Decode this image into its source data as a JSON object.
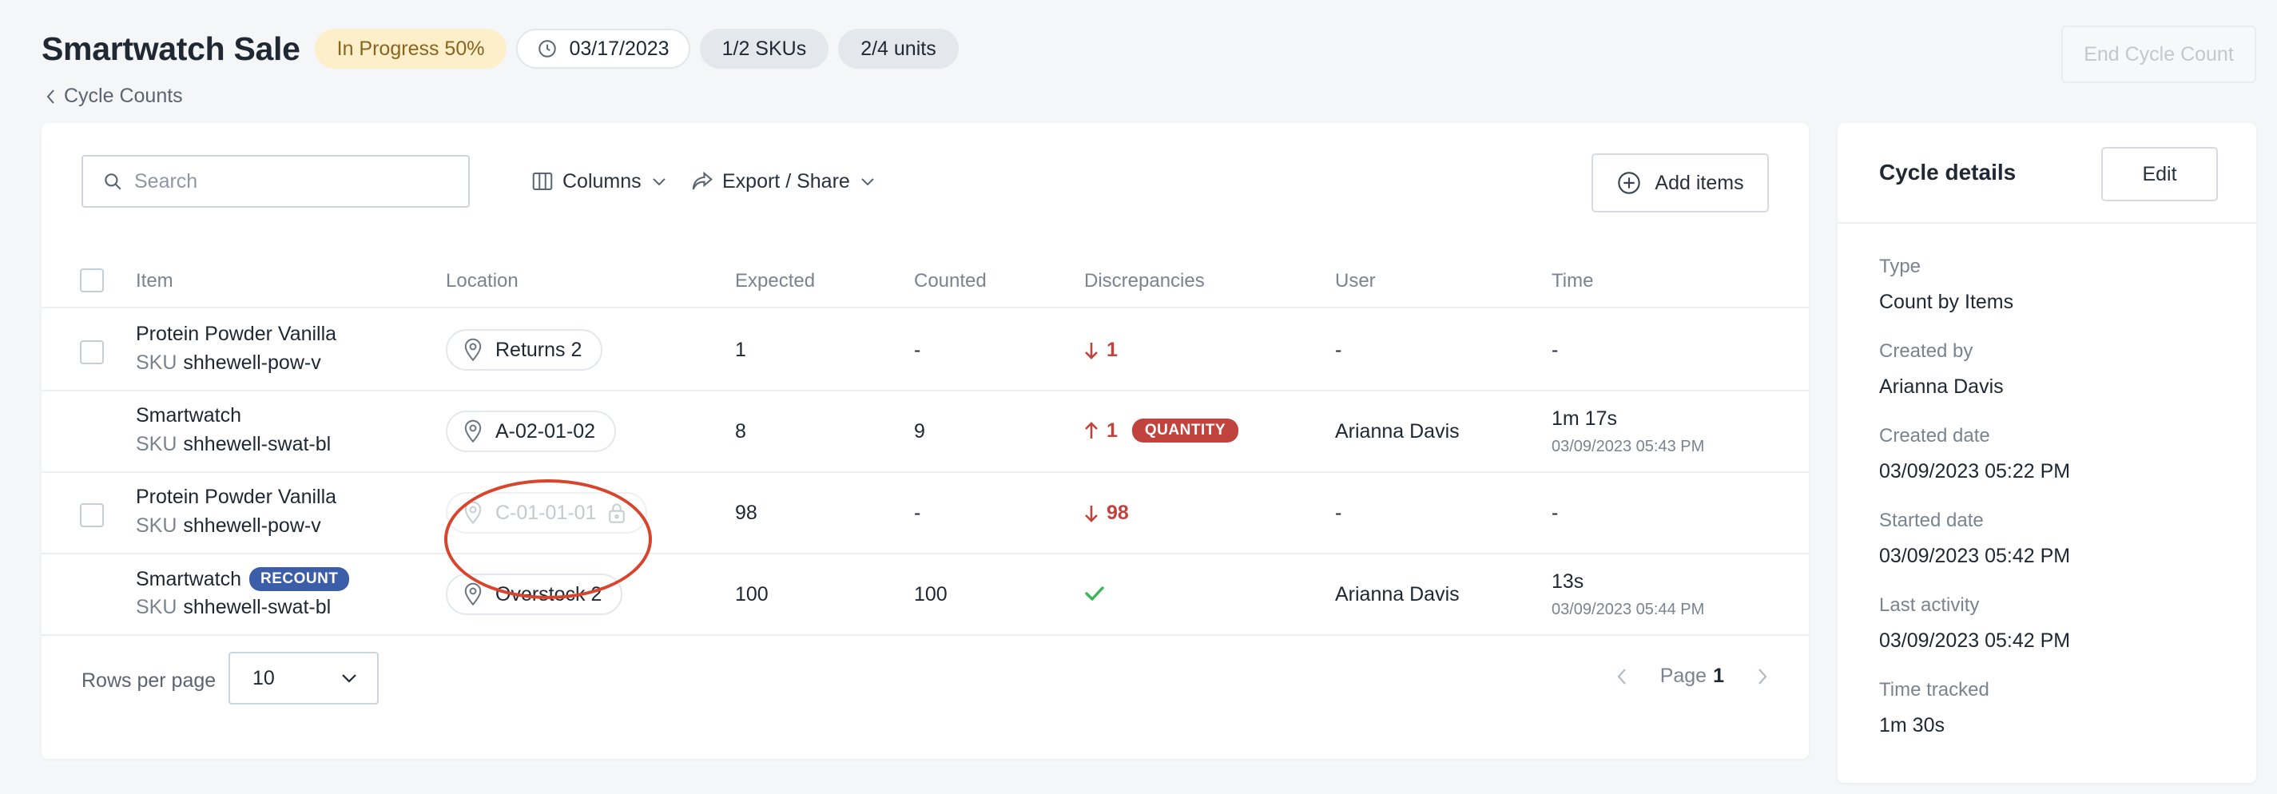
{
  "header": {
    "title": "Smartwatch Sale",
    "status": "In Progress 50%",
    "date": "03/17/2023",
    "skus": "1/2 SKUs",
    "units": "2/4 units",
    "end_button": "End Cycle Count",
    "breadcrumb": "Cycle Counts"
  },
  "toolbar": {
    "search_placeholder": "Search",
    "columns_label": "Columns",
    "export_label": "Export / Share",
    "add_items_label": "Add items"
  },
  "table": {
    "headers": {
      "item": "Item",
      "location": "Location",
      "expected": "Expected",
      "counted": "Counted",
      "discrepancies": "Discrepancies",
      "user": "User",
      "time": "Time"
    },
    "sku_label": "SKU",
    "rows": [
      {
        "name": "Protein Powder Vanilla",
        "sku": "shhewell-pow-v",
        "location": "Returns 2",
        "expected": "1",
        "counted": "-",
        "discrepancy": "1",
        "discrepancy_dir": "down",
        "user": "-",
        "time": "-",
        "time_sub": ""
      },
      {
        "name": "Smartwatch",
        "sku": "shhewell-swat-bl",
        "location": "A-02-01-02",
        "expected": "8",
        "counted": "9",
        "discrepancy": "1",
        "discrepancy_dir": "up",
        "discrepancy_badge": "QUANTITY",
        "user": "Arianna Davis",
        "time": "1m 17s",
        "time_sub": "03/09/2023 05:43 PM"
      },
      {
        "name": "Protein Powder Vanilla",
        "sku": "shhewell-pow-v",
        "location": "C-01-01-01",
        "expected": "98",
        "counted": "-",
        "discrepancy": "98",
        "discrepancy_dir": "down",
        "user": "-",
        "time": "-",
        "time_sub": ""
      },
      {
        "name": "Smartwatch",
        "badge": "RECOUNT",
        "sku": "shhewell-swat-bl",
        "location": "Overstock 2",
        "expected": "100",
        "counted": "100",
        "discrepancy": "",
        "discrepancy_dir": "check",
        "user": "Arianna Davis",
        "time": "13s",
        "time_sub": "03/09/2023 05:44 PM"
      }
    ]
  },
  "pagination": {
    "rows_per_page_label": "Rows per page",
    "rows_per_page_value": "10",
    "page_label": "Page",
    "page_number": "1"
  },
  "cycle_details": {
    "title": "Cycle details",
    "edit_label": "Edit",
    "fields": [
      {
        "label": "Type",
        "value": "Count by Items"
      },
      {
        "label": "Created by",
        "value": "Arianna Davis"
      },
      {
        "label": "Created date",
        "value": "03/09/2023 05:22 PM"
      },
      {
        "label": "Started date",
        "value": "03/09/2023 05:42 PM"
      },
      {
        "label": "Last activity",
        "value": "03/09/2023 05:42 PM"
      },
      {
        "label": "Time tracked",
        "value": "1m 30s"
      }
    ]
  },
  "colors": {
    "progress_bg": "#fcefc9",
    "discrepancy_red": "#c0433d",
    "recount_blue": "#3c5da8",
    "check_green": "#3bb55c",
    "callout_red": "#d9442d"
  },
  "icons": [
    "clock-icon",
    "chevron-left-icon",
    "search-icon",
    "columns-icon",
    "share-icon",
    "chevron-down-icon",
    "plus-circle-icon",
    "pin-icon",
    "lock-icon",
    "arrow-down-icon",
    "arrow-up-icon",
    "check-icon",
    "chevron-right-icon"
  ]
}
